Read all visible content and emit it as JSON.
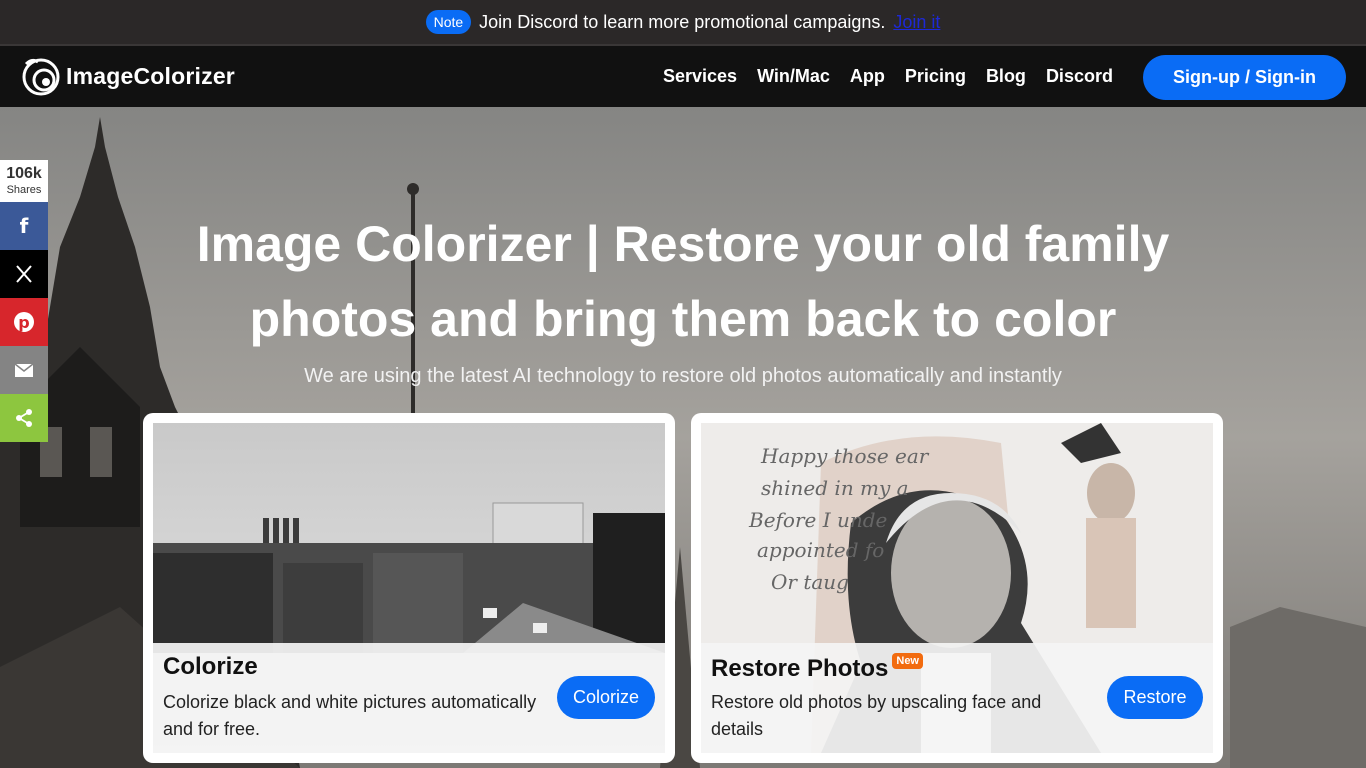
{
  "announcement": {
    "badge": "Note",
    "text": "Join Discord to learn more promotional campaigns.",
    "link": "Join it"
  },
  "header": {
    "logo_text": "ImageColorizer",
    "nav": [
      "Services",
      "Win/Mac",
      "App",
      "Pricing",
      "Blog",
      "Discord"
    ],
    "signin_label": "Sign-up / Sign-in"
  },
  "hero": {
    "title": "Image Colorizer | Restore your old family photos and bring them back to color",
    "subtitle": "We are using the latest AI technology to restore old photos automatically and instantly"
  },
  "share": {
    "count": "106k",
    "count_label": "Shares",
    "buttons": [
      {
        "icon": "facebook-icon",
        "color": "#3b5998"
      },
      {
        "icon": "x-icon",
        "color": "#000000"
      },
      {
        "icon": "pinterest-icon",
        "color": "#d7262c"
      },
      {
        "icon": "email-icon",
        "color": "#848484"
      },
      {
        "icon": "share-icon",
        "color": "#8dc63f"
      }
    ]
  },
  "cards": [
    {
      "title": "Colorize",
      "description": "Colorize black and white pictures automatically and for free.",
      "button": "Colorize"
    },
    {
      "title": "Restore Photos",
      "badge": "New",
      "description": "Restore old photos by upscaling face and details",
      "button": "Restore"
    }
  ],
  "colors": {
    "accent": "#0a6cf5",
    "header_bg": "#111111",
    "announcement_bg": "#2b2828",
    "new_badge": "#f26b0f"
  }
}
